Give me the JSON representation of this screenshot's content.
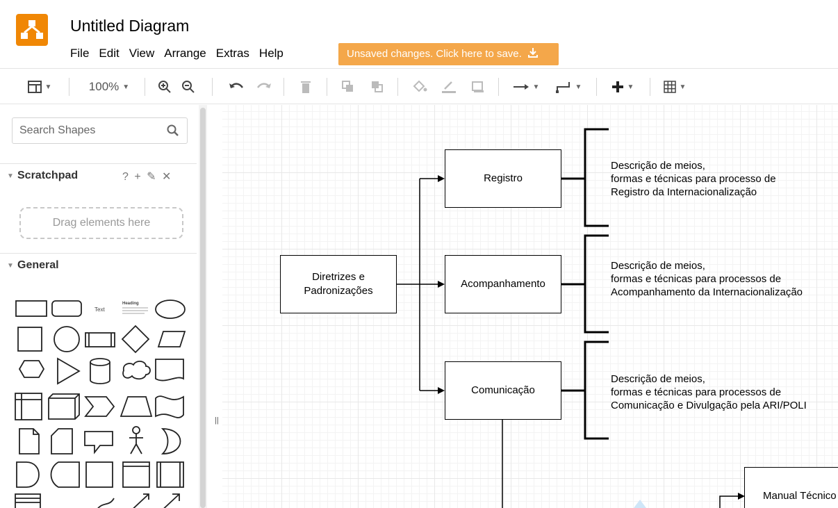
{
  "app": {
    "title": "Untitled Diagram",
    "menu": [
      "File",
      "Edit",
      "View",
      "Arrange",
      "Extras",
      "Help"
    ],
    "save_banner": "Unsaved changes. Click here to save."
  },
  "toolbar": {
    "zoom": "100%",
    "icons": [
      "format-panel-icon",
      "zoom-in-icon",
      "zoom-out-icon",
      "undo-icon",
      "redo-icon",
      "delete-icon",
      "to-front-icon",
      "to-back-icon",
      "fill-color-icon",
      "line-color-icon",
      "shadow-icon",
      "connection-icon",
      "waypoints-icon",
      "insert-icon",
      "table-icon"
    ]
  },
  "sidebar": {
    "search_placeholder": "Search Shapes",
    "scratchpad": {
      "title": "Scratchpad",
      "tools": "? + ✎ ✕",
      "drop_hint": "Drag elements here"
    },
    "general": {
      "title": "General",
      "text_shape": "Text",
      "heading_shape": "Heading",
      "list_item_shape": "List Item"
    }
  },
  "diagram": {
    "root": "Diretrizes e\nPadronizações",
    "nodes": [
      "Registro",
      "Acompanhamento",
      "Comunicação",
      "Manual Técnico"
    ],
    "descriptions": [
      "Descrição de meios,\nformas e técnicas para processo de\nRegistro da Internacionalização",
      "Descrição de meios,\nformas e técnicas para processos de\nAcompanhamento da Internacionalização",
      "Descrição de meios,\nformas e técnicas para processos de\nComunicação e Divulgação pela ARI/POLI"
    ]
  },
  "colors": {
    "brand": "#f08705",
    "banner": "#f4a74a"
  }
}
